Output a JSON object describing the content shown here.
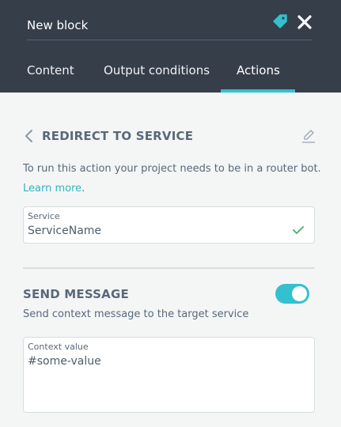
{
  "header": {
    "title": "New block",
    "tabs": [
      {
        "label": "Content"
      },
      {
        "label": "Output conditions"
      },
      {
        "label": "Actions",
        "active": true
      }
    ]
  },
  "action": {
    "title": "REDIRECT TO SERVICE",
    "description": "To run this action your project needs to be in a router bot.",
    "learn_more": "Learn more",
    "learn_more_suffix": ".",
    "service": {
      "label": "Service",
      "value": "ServiceName",
      "valid": true
    }
  },
  "send_message": {
    "title": "SEND MESSAGE",
    "enabled": true,
    "description": "Send context message to the target service",
    "context": {
      "label": "Context value",
      "value": "#some-value"
    }
  },
  "icons": {
    "tag": "tag-icon",
    "close": "close-icon",
    "back": "chevron-left-icon",
    "edit": "pencil-icon",
    "check": "check-icon"
  },
  "colors": {
    "header_bg": "#363e4a",
    "accent": "#33c1cf",
    "link": "#33b2c4",
    "success": "#3fb06e",
    "page_bg": "#f4f6f6"
  }
}
